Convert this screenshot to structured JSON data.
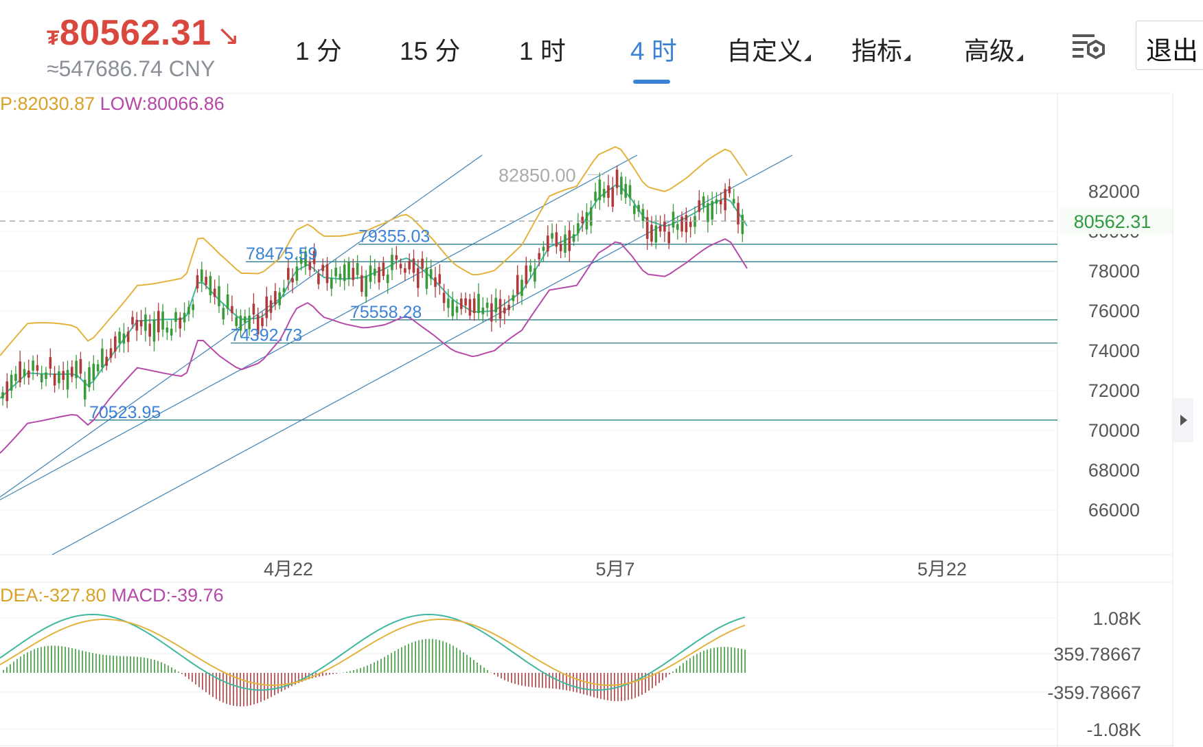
{
  "header": {
    "currency_symbol": "₮",
    "price": "80562.31",
    "trend_arrow": "↘",
    "cny_value": "≈547686.74 CNY",
    "tabs": [
      {
        "label": "1 分",
        "active": false
      },
      {
        "label": "15 分",
        "active": false
      },
      {
        "label": "1 时",
        "active": false
      },
      {
        "label": "4 时",
        "active": true
      },
      {
        "label": "自定义",
        "active": false,
        "dropdown": true
      },
      {
        "label": "指标",
        "active": false,
        "dropdown": true
      },
      {
        "label": "高级",
        "active": false,
        "dropdown": true
      }
    ],
    "settings_icon": "chart-settings-icon",
    "exit_label": "退出"
  },
  "colors": {
    "up": "#3a9a3a",
    "down": "#b03a3a",
    "price_red": "#d9483f",
    "upper_band": "#e3b23c",
    "mid_band": "#3fb7a0",
    "lower_band": "#b548a9",
    "channel": "#3b82b6",
    "level_line": "#2c7a8a",
    "price_tag": "#2f9a3f",
    "active_tab": "#3b82d6"
  },
  "info": {
    "upper_label": "P:82030.87",
    "lower_label": "LOW:80066.86",
    "dea_label": "DEA:-327.80",
    "macd_label": "MACD:-39.76"
  },
  "chart_data": {
    "type": "candlestick",
    "last_price": "80562.31",
    "y_axis_ticks": [
      "82000",
      "80000",
      "78000",
      "76000",
      "74000",
      "72000",
      "70000",
      "68000",
      "66000"
    ],
    "ylim": [
      64500,
      84000
    ],
    "x_axis_ticks": [
      "4月22",
      "5月7",
      "5月22"
    ],
    "annotations": [
      {
        "text": "82850.00",
        "value": 82850
      },
      {
        "text": "79355.03",
        "value": 79355.03
      },
      {
        "text": "78475.59",
        "value": 78475.59
      },
      {
        "text": "75558.28",
        "value": 75558.28
      },
      {
        "text": "74392.73",
        "value": 74392.73
      },
      {
        "text": "70523.95",
        "value": 70523.95
      }
    ],
    "macd_axis_ticks": [
      "1.08K",
      "359.78667",
      "-359.78667",
      "-1.08K"
    ]
  }
}
